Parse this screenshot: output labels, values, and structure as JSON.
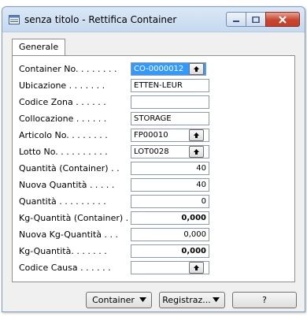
{
  "window": {
    "title": "senza titolo - Rettifica Container"
  },
  "tabs": [
    {
      "label": "Generale"
    }
  ],
  "fields": [
    {
      "label": "Container No. . . . . . . .",
      "value": "CO-0000012",
      "assist": true,
      "selected": true
    },
    {
      "label": "Ubicazione . . . . . . .",
      "value": "ETTEN-LEUR"
    },
    {
      "label": "Codice Zona . . . . . .",
      "value": ""
    },
    {
      "label": "Collocazione . . . . . .",
      "value": "STORAGE"
    },
    {
      "label": "Articolo No. . . . . . . .",
      "value": "FP00010",
      "assist": true
    },
    {
      "label": "Lotto No. . . . . . . . . .",
      "value": "LOT0028",
      "assist": true
    },
    {
      "label": "Quantità (Container) . .",
      "value": "40",
      "numeric": true
    },
    {
      "label": "Nuova Quantità . . . . .",
      "value": "40",
      "numeric": true
    },
    {
      "label": "Quantità . . . . . . . . .",
      "value": "0",
      "numeric": true
    },
    {
      "label": "Kg-Quantità (Container) .",
      "value": "0,000",
      "numeric": true,
      "bold": true
    },
    {
      "label": "Nuova Kg-Quantità . . .",
      "value": "0,000",
      "numeric": true
    },
    {
      "label": "Kg-Quantità. . . . . . .",
      "value": "0,000",
      "numeric": true,
      "bold": true
    },
    {
      "label": "Codice Causa . . . . . .",
      "value": "",
      "assist": true
    }
  ],
  "buttons": {
    "container": "Container",
    "registraz": "Registraz...",
    "help": "?"
  },
  "colors": {
    "selection": "#3399ff",
    "close_button": "#c8452f"
  }
}
